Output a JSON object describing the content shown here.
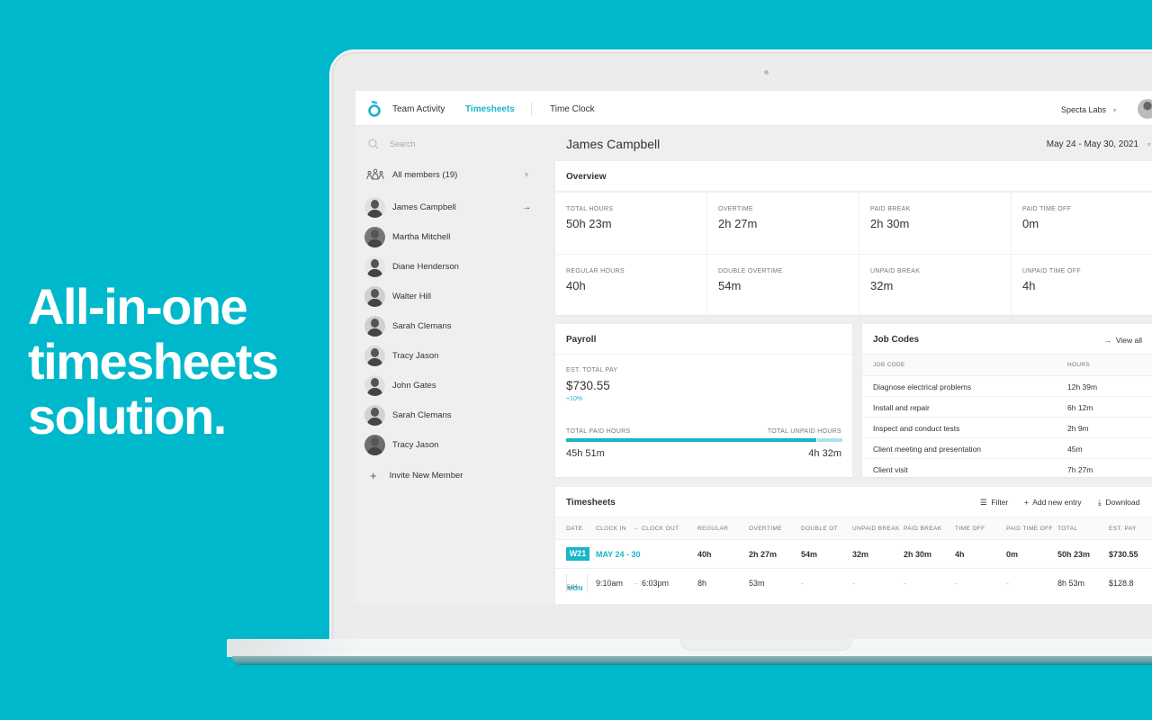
{
  "headline": [
    "All-in-one",
    "timesheets",
    "solution."
  ],
  "colors": {
    "background": "#00b8cc",
    "accent": "#19b5c9",
    "accent_light": "#a8e3ea"
  },
  "topnav": {
    "logo": "app-logo-icon",
    "items": [
      {
        "label": "Team Activity",
        "active": false
      },
      {
        "label": "Timesheets",
        "active": true
      },
      {
        "label": "Time Clock",
        "active": false
      }
    ],
    "org": "Specta Labs"
  },
  "sidebar": {
    "search_placeholder": "Search",
    "members_filter": "All members (19)",
    "members": [
      {
        "name": "James Campbell",
        "selected": true
      },
      {
        "name": "Martha Mitchell"
      },
      {
        "name": "Diane Henderson"
      },
      {
        "name": "Walter Hill"
      },
      {
        "name": "Sarah Clemans"
      },
      {
        "name": "Tracy Jason"
      },
      {
        "name": "John Gates"
      },
      {
        "name": "Sarah Clemans"
      },
      {
        "name": "Tracy Jason"
      }
    ],
    "invite_label": "Invite New Member"
  },
  "main": {
    "person": "James Campbell",
    "date_range": "May 24 - May 30, 2021",
    "overview": {
      "title": "Overview",
      "cells": [
        {
          "label": "TOTAL HOURS",
          "value": "50h 23m"
        },
        {
          "label": "OVERTIME",
          "value": "2h 27m"
        },
        {
          "label": "PAID BREAK",
          "value": "2h 30m"
        },
        {
          "label": "PAID TIME OFF",
          "value": "0m"
        },
        {
          "label": "REGULAR HOURS",
          "value": "40h"
        },
        {
          "label": "DOUBLE OVERTIME",
          "value": "54m"
        },
        {
          "label": "UNPAID BREAK",
          "value": "32m"
        },
        {
          "label": "UNPAID TIME OFF",
          "value": "4h"
        }
      ]
    },
    "payroll": {
      "title": "Payroll",
      "est_label": "EST. TOTAL PAY",
      "est_value": "$730.55",
      "change": "+10%",
      "paid_label": "TOTAL PAID HOURS",
      "unpaid_label": "TOTAL UNPAID HOURS",
      "paid_value": "45h 51m",
      "unpaid_value": "4h 32m",
      "paid_fraction": 0.91
    },
    "job_codes": {
      "title": "Job Codes",
      "view_all": "View all",
      "headers": [
        "JOB CODE",
        "HOURS"
      ],
      "rows": [
        {
          "code": "Diagnose electrical problems",
          "hours": "12h 39m"
        },
        {
          "code": "Install and repair",
          "hours": "6h 12m"
        },
        {
          "code": "Inspect and conduct tests",
          "hours": "2h 9m"
        },
        {
          "code": "Client meeting and presentation",
          "hours": "45m"
        },
        {
          "code": "Client visit",
          "hours": "7h 27m"
        }
      ]
    },
    "timesheets": {
      "title": "Timesheets",
      "actions": {
        "filter": "Filter",
        "add": "Add new entry",
        "download": "Download"
      },
      "headers": {
        "date": "DATE",
        "clock_in": "CLOCK IN",
        "clock_out": "CLOCK OUT",
        "regular": "REGULAR",
        "overtime": "OVERTIME",
        "double_ot": "DOUBLE OT",
        "unpaid_break": "UNPAID BREAK",
        "paid_break": "PAID BREAK",
        "time_off": "TIME OFF",
        "paid_time_off": "PAID TIME OFF",
        "total": "TOTAL",
        "est_pay": "EST. PAY"
      },
      "week_row": {
        "badge": "W21",
        "label": "MAY 24 - 30",
        "regular": "40h",
        "overtime": "2h 27m",
        "double_ot": "54m",
        "unpaid_break": "32m",
        "paid_break": "2h 30m",
        "time_off": "4h",
        "paid_time_off": "0m",
        "total": "50h 23m",
        "est_pay": "$730.55"
      },
      "day_row": {
        "dow": "MON",
        "date": "5/24",
        "clock_in": "9:10am",
        "clock_out": "6:03pm",
        "regular": "8h",
        "overtime": "53m",
        "double_ot": "-",
        "unpaid_break": "-",
        "paid_break": "-",
        "time_off": "-",
        "paid_time_off": "-",
        "total": "8h 53m",
        "est_pay": "$128.8"
      }
    }
  }
}
